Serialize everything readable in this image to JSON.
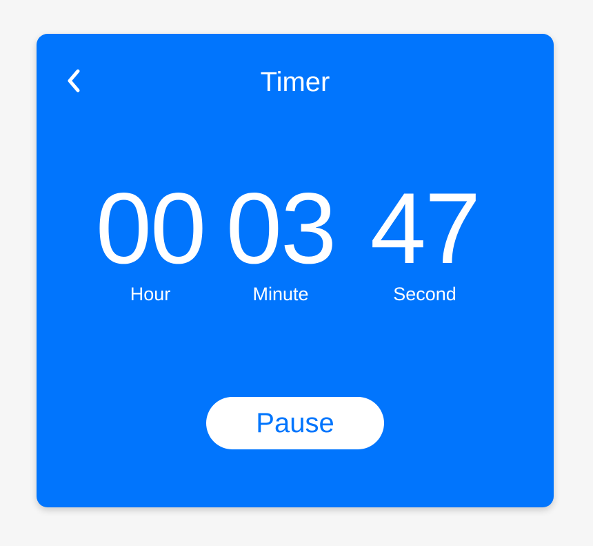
{
  "app": {
    "title": "Timer"
  },
  "icons": {
    "back": "chevron-left-icon"
  },
  "colors": {
    "background": "#f6f6f6",
    "card": "#0175fd",
    "text": "#ffffff",
    "button_bg": "#ffffff",
    "button_text": "#0175fd"
  },
  "timer": {
    "hours": "00",
    "minutes": "03",
    "seconds": "47",
    "hours_label": "Hour",
    "minutes_label": "Minute",
    "seconds_label": "Second"
  },
  "controls": {
    "pause_label": "Pause"
  }
}
